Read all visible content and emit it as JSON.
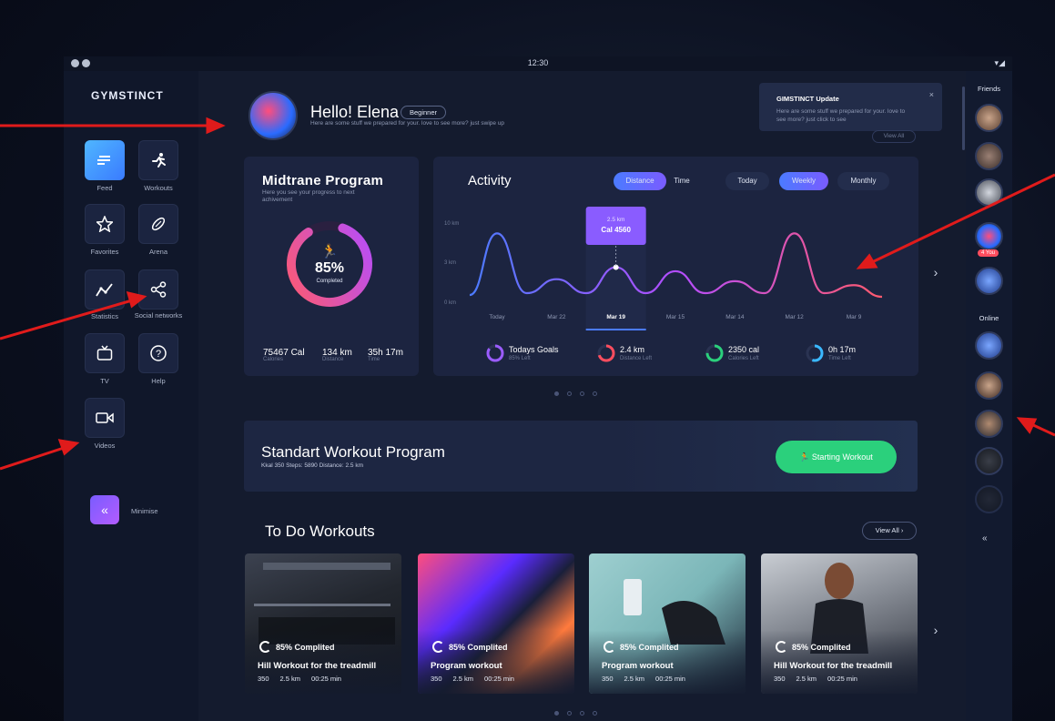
{
  "status": {
    "time": "12:30",
    "signal": "▾◢"
  },
  "brand": {
    "logo": "GYMSTINCT",
    "accent": "#3a7bff",
    "green": "#2bd07c"
  },
  "sidebar": {
    "items": [
      {
        "label": "Feed",
        "icon": "feed-icon",
        "glyph": "≡"
      },
      {
        "label": "Workouts",
        "icon": "running-man-icon",
        "glyph": "🏃"
      },
      {
        "label": "Favorites",
        "icon": "star-icon",
        "glyph": "☆"
      },
      {
        "label": "Arena",
        "icon": "rugby-ball-icon",
        "glyph": "⊘"
      },
      {
        "label": "Statistics",
        "icon": "chart-line-icon",
        "glyph": "〽"
      },
      {
        "label": "Social networks",
        "icon": "share-icon",
        "glyph": "⋖"
      },
      {
        "label": "TV",
        "icon": "tv-icon",
        "glyph": "▭"
      },
      {
        "label": "Help",
        "icon": "help-icon",
        "glyph": "?"
      },
      {
        "label": "Videos",
        "icon": "video-icon",
        "glyph": "▭"
      }
    ],
    "minimise": "Minimise",
    "minimise_glyph": "«"
  },
  "header": {
    "greeting": "Hello! Elena",
    "level": "Beginner",
    "subtitle": "Here are some stuff we prepared for your. love to see more? just swipe up"
  },
  "notification": {
    "title": "GIMSTINCT Update",
    "text": "Here are some stuff we prepared for your. love to see more? just click to see",
    "close": "×",
    "view_all": "View All"
  },
  "program": {
    "title": "Midtrane Program",
    "subtitle": "Here you see your progress to next achivement",
    "percent": "85%",
    "percent_value": 0.85,
    "completed": "Completed",
    "stats": [
      {
        "value": "75467 Cal",
        "label": "Calories"
      },
      {
        "value": "134 km",
        "label": "Distance"
      },
      {
        "value": "35h 17m",
        "label": "Time"
      }
    ]
  },
  "activity": {
    "title": "Activity",
    "toggles": [
      "Distance",
      "Time"
    ],
    "periods": [
      "Today",
      "Weekly",
      "Monthly"
    ],
    "tooltip": {
      "distance": "2.5 km",
      "cal": "Cal 4560"
    },
    "goals": [
      {
        "value": "Todays Goals",
        "label": "85% Left",
        "color": "#9b5cff",
        "fill": 0.85
      },
      {
        "value": "2.4 km",
        "label": "Distance Left",
        "color": "#ff4d5e",
        "fill": 0.7
      },
      {
        "value": "2350 cal",
        "label": "Calories Left",
        "color": "#2bd07c",
        "fill": 0.75
      },
      {
        "value": "0h 17m",
        "label": "Time Left",
        "color": "#3ab8ff",
        "fill": 0.55
      }
    ]
  },
  "chart_data": {
    "type": "line",
    "categories": [
      "Today",
      "Mar 22",
      "Mar 19",
      "Mar 15",
      "Mar 14",
      "Mar 12",
      "Mar 9"
    ],
    "ytick_labels": [
      "10 km",
      "3 km",
      "0 km"
    ],
    "series": [
      {
        "values": [
          3.0,
          0.7,
          1.3,
          1.1,
          0.6,
          3.0,
          0.4
        ]
      }
    ],
    "highlight": "Mar 19"
  },
  "banner": {
    "title": "Standart Workout Program",
    "subtitle": "Kkal 350   Steps: 5890    Distance: 2.5 km",
    "button": "Starting Workout"
  },
  "todo": {
    "title": "To Do Workouts",
    "view_all": "View All  ›",
    "cards": [
      {
        "progress": "85% Complited",
        "name": "Hill Workout for the treadmill",
        "cal": "350",
        "dist": "2.5 km",
        "time": "00:25 min"
      },
      {
        "progress": "85% Complited",
        "name": "Program workout",
        "cal": "350",
        "dist": "2.5 km",
        "time": "00:25 min"
      },
      {
        "progress": "85% Complited",
        "name": "Program workout",
        "cal": "350",
        "dist": "2.5 km",
        "time": "00:25 min"
      },
      {
        "progress": "85% Complited",
        "name": "Hill Workout for the treadmill",
        "cal": "350",
        "dist": "2.5 km",
        "time": "00:25 min"
      }
    ]
  },
  "rail": {
    "friends_title": "Friends",
    "online_title": "Online",
    "you_badge": "4 You",
    "collapse": "«"
  },
  "nav": {
    "next": "›"
  }
}
